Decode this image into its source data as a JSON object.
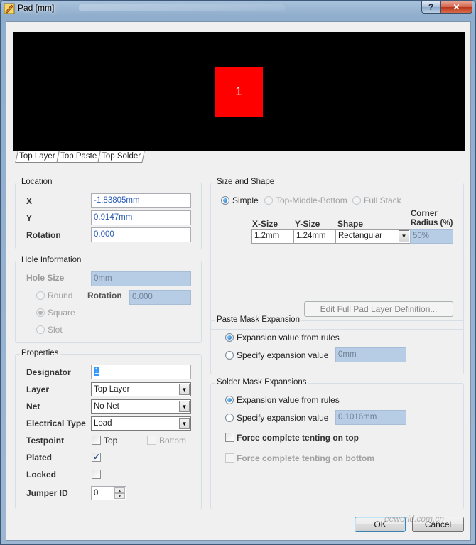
{
  "window": {
    "title": "Pad [mm]",
    "help_label": "?",
    "close_label": "✕"
  },
  "preview": {
    "pad_designator": "1",
    "pad_color": "#ff0000",
    "background": "#000000",
    "layer_tabs": [
      "Top Layer",
      "Top Paste",
      "Top Solder"
    ]
  },
  "location": {
    "title": "Location",
    "x_label": "X",
    "x_value": "-1.83805mm",
    "y_label": "Y",
    "y_value": "0.9147mm",
    "rotation_label": "Rotation",
    "rotation_value": "0.000"
  },
  "hole": {
    "title": "Hole Information",
    "size_label": "Hole Size",
    "size_value": "0mm",
    "round_label": "Round",
    "square_label": "Square",
    "slot_label": "Slot",
    "rotation_label": "Rotation",
    "rotation_value": "0.000"
  },
  "properties": {
    "title": "Properties",
    "designator_label": "Designator",
    "designator_value": "1",
    "layer_label": "Layer",
    "layer_value": "Top Layer",
    "net_label": "Net",
    "net_value": "No Net",
    "electrical_label": "Electrical Type",
    "electrical_value": "Load",
    "testpoint_label": "Testpoint",
    "testpoint_top": "Top",
    "testpoint_bottom": "Bottom",
    "plated_label": "Plated",
    "locked_label": "Locked",
    "jumper_label": "Jumper ID",
    "jumper_value": "0"
  },
  "size_shape": {
    "title": "Size and Shape",
    "simple_label": "Simple",
    "tmb_label": "Top-Middle-Bottom",
    "fullstack_label": "Full Stack",
    "col_xsize": "X-Size",
    "col_ysize": "Y-Size",
    "col_shape": "Shape",
    "col_corner": "Corner Radius (%)",
    "xsize_value": "1.2mm",
    "ysize_value": "1.24mm",
    "shape_value": "Rectangular",
    "corner_value": "50%",
    "edit_button": "Edit Full Pad Layer Definition..."
  },
  "paste_mask": {
    "title": "Paste Mask Expansion",
    "from_rules_label": "Expansion value from rules",
    "specify_label": "Specify expansion value",
    "value": "0mm"
  },
  "solder_mask": {
    "title": "Solder Mask Expansions",
    "from_rules_label": "Expansion value from rules",
    "specify_label": "Specify expansion value",
    "value": "0.1016mm",
    "tent_top_label": "Force complete tenting on top",
    "tent_bottom_label": "Force complete tenting on bottom"
  },
  "buttons": {
    "ok": "OK",
    "cancel": "Cancel"
  },
  "watermark": "eeworld.com.cn"
}
